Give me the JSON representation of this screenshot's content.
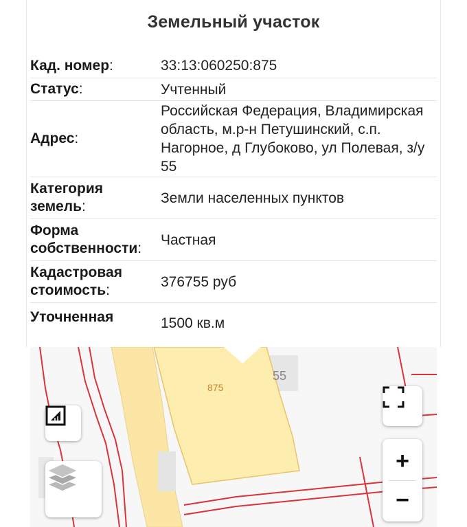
{
  "panel": {
    "title": "Земельный участок"
  },
  "fields": [
    {
      "label": "Кад. номер",
      "colon": ":",
      "value": "33:13:060250:875"
    },
    {
      "label": "Статус",
      "colon": ":",
      "value": "Учтенный"
    },
    {
      "label": "Адрес",
      "colon": ":",
      "value": "Российская Федерация, Владимирская область, м.р-н Петушинский, с.п. Нагорное, д Глубоково, ул Полевая, з/у 55"
    },
    {
      "label_line1": "Категория",
      "label_line2": "земель",
      "colon": ":",
      "value": "Земли населенных пунктов"
    },
    {
      "label_line1": "Форма",
      "label_line2": "собственности",
      "colon": ":",
      "value": "Частная"
    },
    {
      "label_line1": "Кадастровая",
      "label_line2": "стоимость",
      "colon": ":",
      "value": "376755 руб"
    },
    {
      "label": "Уточненная",
      "value": "1500 кв.м"
    }
  ],
  "map": {
    "parcel_label": "875",
    "neighbor_label": "55",
    "parcel_fill": "#fdeeb0",
    "parcel_stroke": "#e9c36a",
    "road_fill": "#fbe6a6",
    "boundary_color": "#d9333b",
    "controls": {
      "plus": "+",
      "minus": "−"
    }
  }
}
